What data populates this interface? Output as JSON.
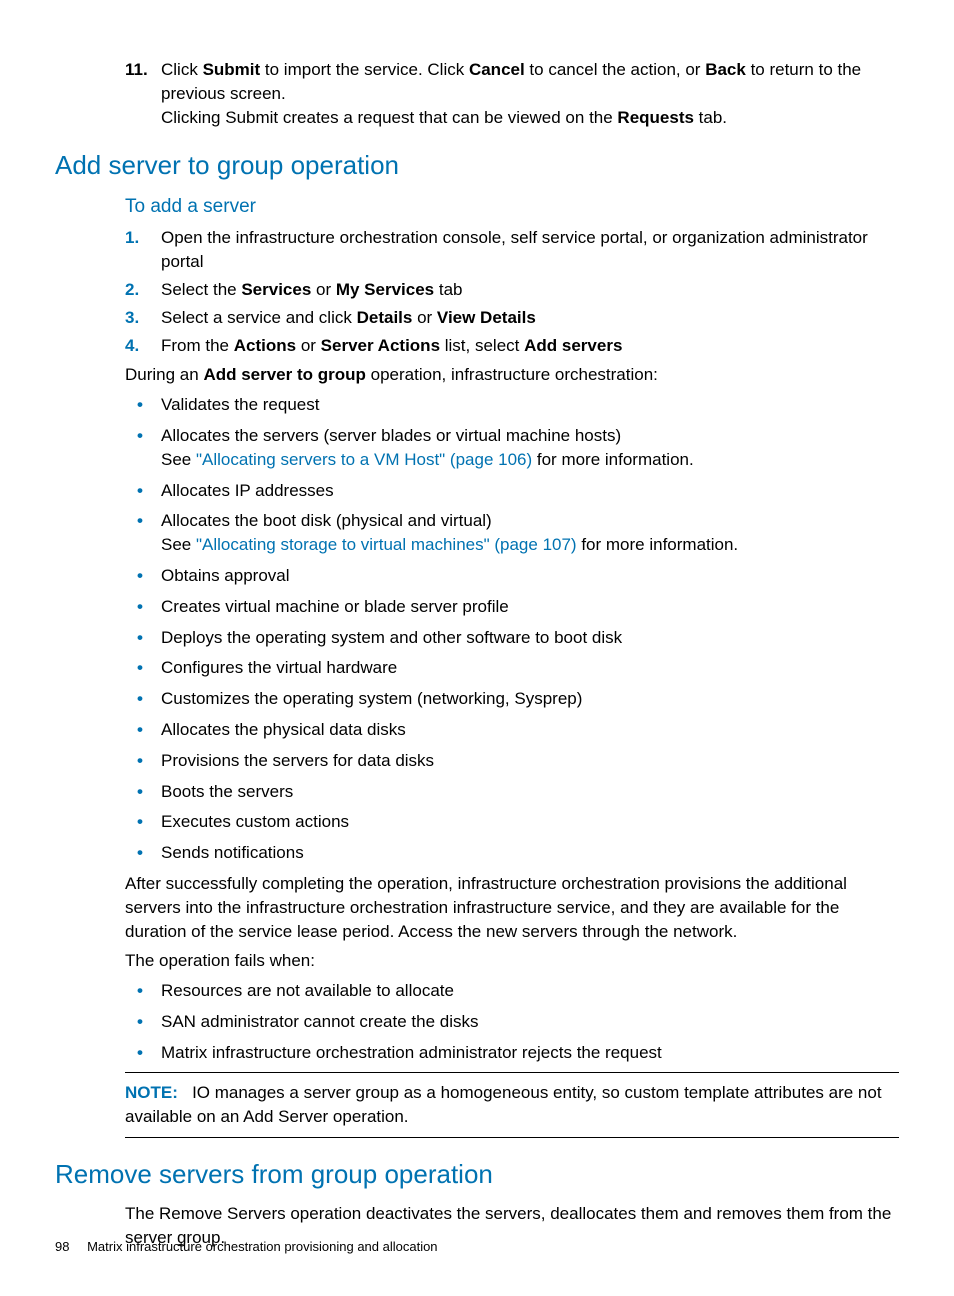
{
  "step11": {
    "num": "11.",
    "text_pre": "Click ",
    "submit": "Submit",
    "mid1": " to import the service. Click ",
    "cancel": "Cancel",
    "mid2": " to cancel the action, or ",
    "back": "Back",
    "mid3": " to return to the previous screen.",
    "line2_pre": "Clicking Submit creates a request that can be viewed on the ",
    "requests": "Requests",
    "line2_post": " tab."
  },
  "h_add": "Add server to group operation",
  "h_toadd": "To add a server",
  "steps": [
    {
      "n": "1.",
      "text": "Open the infrastructure orchestration console, self service portal, or organization administrator portal"
    },
    {
      "n": "2.",
      "pre": "Select the ",
      "b1": "Services",
      "mid": " or ",
      "b2": "My Services",
      "post": " tab"
    },
    {
      "n": "3.",
      "pre": "Select a service and click ",
      "b1": "Details",
      "mid": " or ",
      "b2": "View Details",
      "post": ""
    },
    {
      "n": "4.",
      "pre": "From the ",
      "b1": "Actions",
      "mid": " or ",
      "b2": "Server Actions",
      "post_pre": " list, select ",
      "b3": "Add servers"
    }
  ],
  "during_pre": "During an ",
  "during_b": "Add server to group",
  "during_post": " operation, infrastructure orchestration:",
  "ops": {
    "i0": "Validates the request",
    "i1_a": "Allocates the servers (server blades or virtual machine hosts)",
    "i1_see_pre": "See ",
    "i1_link": "\"Allocating servers to a VM Host\" (page 106)",
    "i1_see_post": " for more information.",
    "i2": "Allocates IP addresses",
    "i3_a": "Allocates the boot disk (physical and virtual)",
    "i3_see_pre": "See ",
    "i3_link": "\"Allocating storage to virtual machines\" (page 107)",
    "i3_see_post": " for more information.",
    "i4": "Obtains approval",
    "i5": "Creates virtual machine or blade server profile",
    "i6": "Deploys the operating system and other software to boot disk",
    "i7": "Configures the virtual hardware",
    "i8": "Customizes the operating system (networking, Sysprep)",
    "i9": "Allocates the physical data disks",
    "i10": "Provisions the servers for data disks",
    "i11": "Boots the servers",
    "i12": "Executes custom actions",
    "i13": "Sends notifications"
  },
  "after": "After successfully completing the operation, infrastructure orchestration provisions the additional servers into the infrastructure orchestration infrastructure service, and they are available for the duration of the service lease period. Access the new servers through the network.",
  "fails": "The operation fails when:",
  "fail_items": {
    "f0": "Resources are not available to allocate",
    "f1": "SAN administrator cannot create the disks",
    "f2": "Matrix infrastructure orchestration administrator rejects the request"
  },
  "note_label": "NOTE:",
  "note_text": "IO manages a server group as a homogeneous entity, so custom template attributes are not available on an Add Server operation.",
  "h_remove": "Remove servers from group operation",
  "remove_text": "The Remove Servers operation deactivates the servers, deallocates them and removes them from the server group.",
  "footer": {
    "page": "98",
    "title": "Matrix infrastructure orchestration provisioning and allocation"
  }
}
